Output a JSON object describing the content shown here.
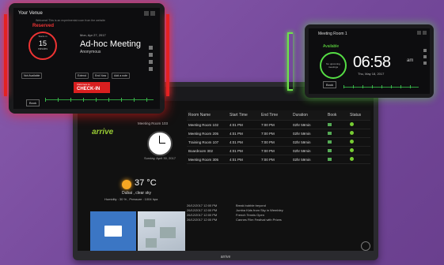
{
  "colors": {
    "background": "#7b4f9e",
    "reserved": "#e32222",
    "available": "#6ee24a",
    "brand": "#99cc33"
  },
  "monitor": {
    "brand": "arrive",
    "logo": "arrive",
    "welcome_room": "Meeting Room 103",
    "date": "Sunday, April 30, 2017",
    "weather": {
      "temp": "37 °C",
      "city": "Dubai , clear sky",
      "details": "Humidity : 30 % , Pressure : 1004 hpa"
    },
    "table": {
      "headers": [
        "Room Name",
        "Start Time",
        "End Time",
        "Duration",
        "Book",
        "Status"
      ],
      "rows": [
        [
          "Meeting Room 102",
          "4:01 PM",
          "7:00 PM",
          "02hr 59min"
        ],
        [
          "Meeting Room 205",
          "4:01 PM",
          "7:00 PM",
          "02hr 59min"
        ],
        [
          "Training Room 107",
          "4:01 PM",
          "7:00 PM",
          "02hr 59min"
        ],
        [
          "Boardroom 302",
          "4:01 PM",
          "7:00 PM",
          "02hr 59min"
        ],
        [
          "Meeting Room 305",
          "4:01 PM",
          "7:00 PM",
          "02hr 59min"
        ]
      ]
    },
    "events": [
      {
        "date": "26/12/2017 12:00 PM",
        "text": "Break bubble beyond"
      },
      {
        "date": "26/12/2017 12:00 PM",
        "text": "Jumba Kids from Sky in Wembley"
      },
      {
        "date": "26/12/2017 12:00 PM",
        "text": "French Tennis Open"
      },
      {
        "date": "26/12/2017 12:00 PM",
        "text": "Cannes Film Festival with Prizes"
      }
    ]
  },
  "red_tablet": {
    "title": "Your Venue",
    "welcome": "Welcome! This is an experimental room from the website",
    "status": "Reserved",
    "starts_in": "Starts in",
    "minutes": "15",
    "min_label": "minutes",
    "time": "Mon, Apr 27, 2017",
    "meeting": "Ad-hoc Meeting",
    "organizer": "Anonymous",
    "not_available": "Not Available",
    "btn1": "Extend",
    "btn2": "End Now",
    "btn3": "Add a note",
    "checkin_small": "Click here to",
    "checkin": "CHECK-IN",
    "book": "Book"
  },
  "green_tablet": {
    "title": "Meeting Room 1",
    "status": "Available",
    "ring_text": "No upcoming meetings",
    "time": "06:58",
    "ampm": "am",
    "date": "Thu, May 18, 2017",
    "book": "Book"
  }
}
